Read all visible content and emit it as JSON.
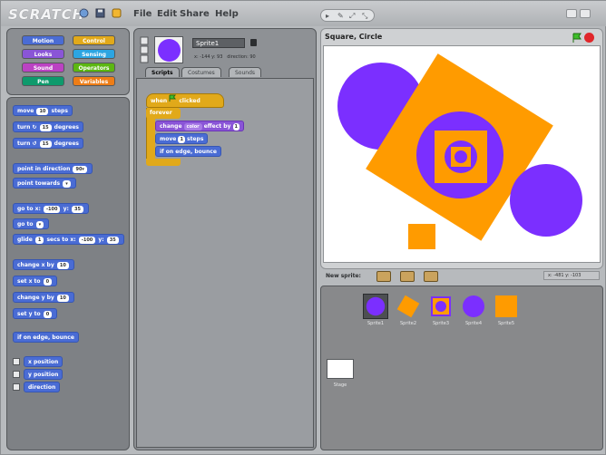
{
  "app": {
    "logo": "SCRATCH"
  },
  "menu": {
    "file": "File",
    "edit": "Edit",
    "share": "Share",
    "help": "Help"
  },
  "categories": [
    {
      "label": "Motion",
      "color": "#4a6cd4"
    },
    {
      "label": "Control",
      "color": "#e1a91a"
    },
    {
      "label": "Looks",
      "color": "#8a55d7"
    },
    {
      "label": "Sensing",
      "color": "#2ca5e2"
    },
    {
      "label": "Sound",
      "color": "#bb42c3"
    },
    {
      "label": "Operators",
      "color": "#5cb712"
    },
    {
      "label": "Pen",
      "color": "#0e9a6c"
    },
    {
      "label": "Variables",
      "color": "#ee7d16"
    }
  ],
  "palette": {
    "move": "move",
    "move_val": "10",
    "move_tail": "steps",
    "turn_cw": "turn ↻",
    "turn_cw_val": "15",
    "turn_cw_tail": "degrees",
    "turn_ccw": "turn ↺",
    "turn_ccw_val": "15",
    "turn_ccw_tail": "degrees",
    "point_dir": "point in direction",
    "point_dir_val": "90▾",
    "point_towards": "point towards",
    "point_towards_val": "▾",
    "goto_xy": "go to x:",
    "goto_x": "-100",
    "goto_y_label": "y:",
    "goto_y": "35",
    "goto": "go to",
    "goto_val": "▾",
    "glide": "glide",
    "glide_secs": "1",
    "glide_mid": "secs to x:",
    "glide_x": "-100",
    "glide_y_label": "y:",
    "glide_y": "35",
    "change_x": "change x by",
    "change_x_val": "10",
    "set_x": "set x to",
    "set_x_val": "0",
    "change_y": "change y by",
    "change_y_val": "10",
    "set_y": "set y to",
    "set_y_val": "0",
    "bounce": "if on edge, bounce",
    "xpos": "x position",
    "ypos": "y position",
    "direction": "direction"
  },
  "sprite": {
    "name": "Sprite1",
    "coords": "x: -144  y: 93",
    "direction": "direction: 90"
  },
  "tabs": {
    "scripts": "Scripts",
    "costumes": "Costumes",
    "sounds": "Sounds"
  },
  "script": {
    "when": "when",
    "clicked": "clicked",
    "forever": "forever",
    "change": "change",
    "effect_val": "color",
    "effect_tail": "effect by",
    "effect_amount": "1",
    "move": "move",
    "move_val": "1",
    "move_tail": "steps",
    "bounce": "if on edge, bounce"
  },
  "stage": {
    "title": "Square, Circle"
  },
  "newsprite": {
    "label": "New sprite:",
    "mouse": "x: -481   y: -103"
  },
  "sprites": [
    {
      "label": "Sprite1"
    },
    {
      "label": "Sprite2"
    },
    {
      "label": "Sprite3"
    },
    {
      "label": "Sprite4"
    },
    {
      "label": "Sprite5"
    }
  ],
  "stage_thumb_label": "Stage",
  "colors": {
    "purple": "#7b2fff",
    "orange": "#ff9b00",
    "motion": "#4a6cd4",
    "control": "#e1a91a",
    "looks": "#8a55d7"
  }
}
